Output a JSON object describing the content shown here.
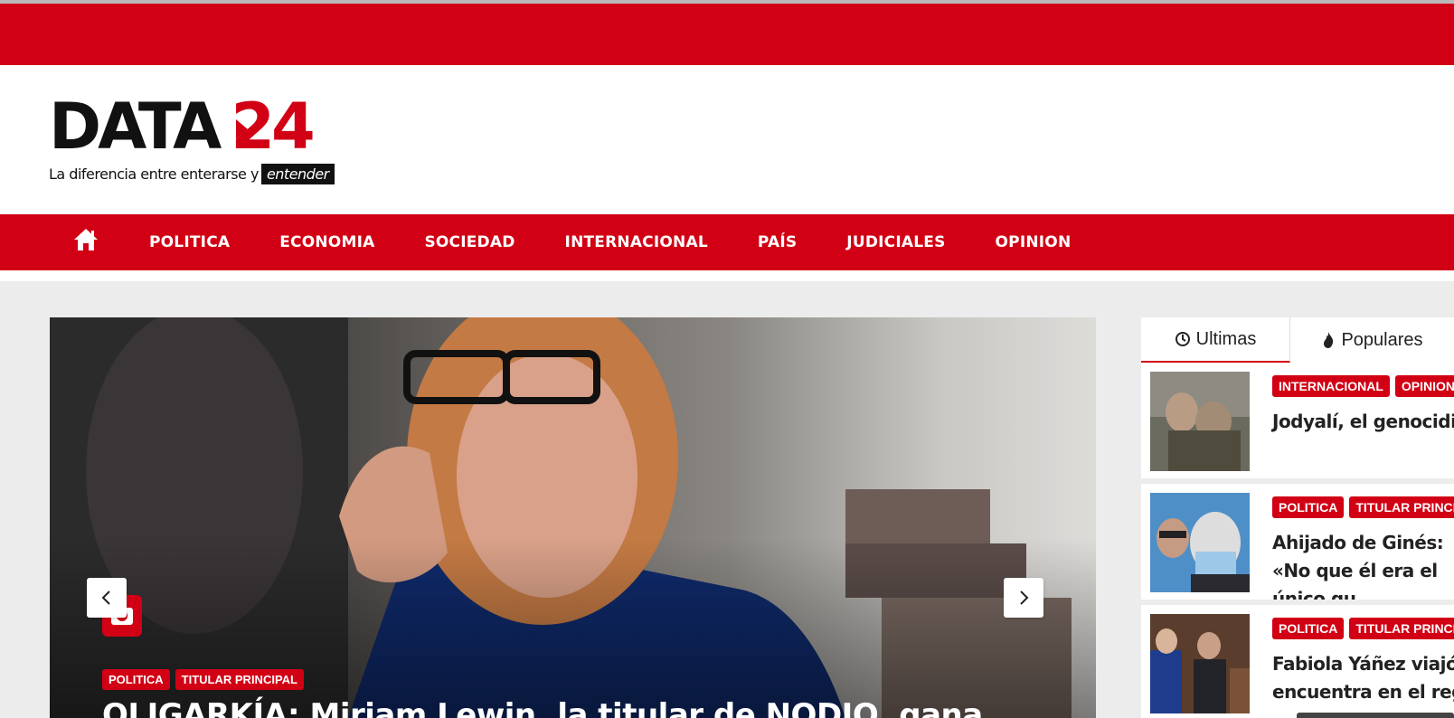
{
  "brand": {
    "name": "DATA",
    "number": "24",
    "tagline": "La diferencia entre enterarse y",
    "tagline_highlight": "entender",
    "accent_color": "#d20014"
  },
  "nav": {
    "home_icon": "home-icon",
    "items": [
      "POLITICA",
      "ECONOMIA",
      "SOCIEDAD",
      "INTERNACIONAL",
      "PAÍS",
      "JUDICIALES",
      "OPINION"
    ]
  },
  "slider": {
    "tags": [
      "POLITICA",
      "TITULAR PRINCIPAL"
    ],
    "title": "OLIGARKÍA: Miriam Lewin, la titular de NODIO, gana",
    "prev_icon": "chevron-left-icon",
    "next_icon": "chevron-right-icon",
    "badge_icon": "camera-icon"
  },
  "sidebar": {
    "tabs": [
      {
        "label": "Ultimas",
        "icon": "clock-icon"
      },
      {
        "label": "Populares",
        "icon": "fire-icon"
      }
    ],
    "posts": [
      {
        "tags": [
          "INTERNACIONAL",
          "OPINION"
        ],
        "title": "Jodyalí, el genocidio q"
      },
      {
        "tags": [
          "POLITICA",
          "TITULAR PRINCIPA"
        ],
        "title": "Ahijado de Ginés: «No que él era el único qu"
      },
      {
        "tags": [
          "POLITICA",
          "TITULAR PRINCIPA"
        ],
        "title": "Fabiola Yáñez viajó a encuentra en el regis"
      }
    ]
  }
}
